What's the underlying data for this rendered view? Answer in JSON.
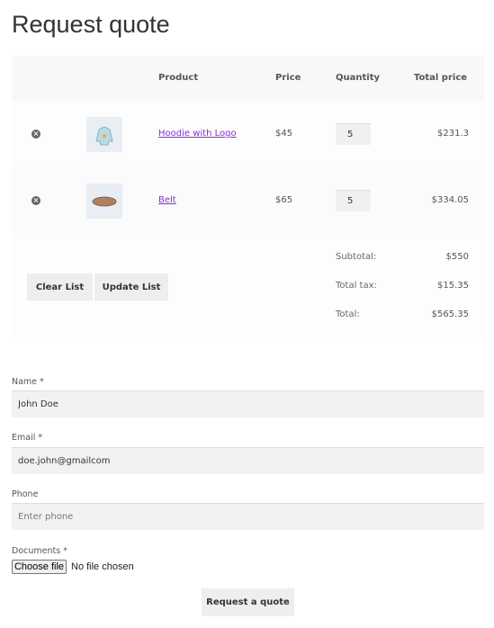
{
  "page": {
    "title": "Request quote"
  },
  "table": {
    "headers": {
      "product": "Product",
      "price": "Price",
      "quantity": "Quantity",
      "total": "Total price"
    },
    "rows": [
      {
        "product": "Hoodie with Logo",
        "price": "$45",
        "quantity": "5",
        "total": "$231.3",
        "remove_icon": "remove-circle-icon"
      },
      {
        "product": "Belt",
        "price": "$65",
        "quantity": "5",
        "total": "$334.05",
        "remove_icon": "remove-circle-icon"
      }
    ]
  },
  "actions": {
    "clear": "Clear List",
    "update": "Update List"
  },
  "totals": {
    "subtotal_label": "Subtotal:",
    "subtotal": "$550",
    "tax_label": "Total tax:",
    "tax": "$15.35",
    "total_label": "Total:",
    "total": "$565.35"
  },
  "form": {
    "name_label": "Name *",
    "name_value": "John Doe",
    "email_label": "Email *",
    "email_value": "doe.john@gmailcom",
    "phone_label": "Phone",
    "phone_placeholder": "Enter phone",
    "documents_label": "Documents *",
    "choose_file": "Choose file",
    "no_file": "No file chosen",
    "submit": "Request a quote"
  }
}
